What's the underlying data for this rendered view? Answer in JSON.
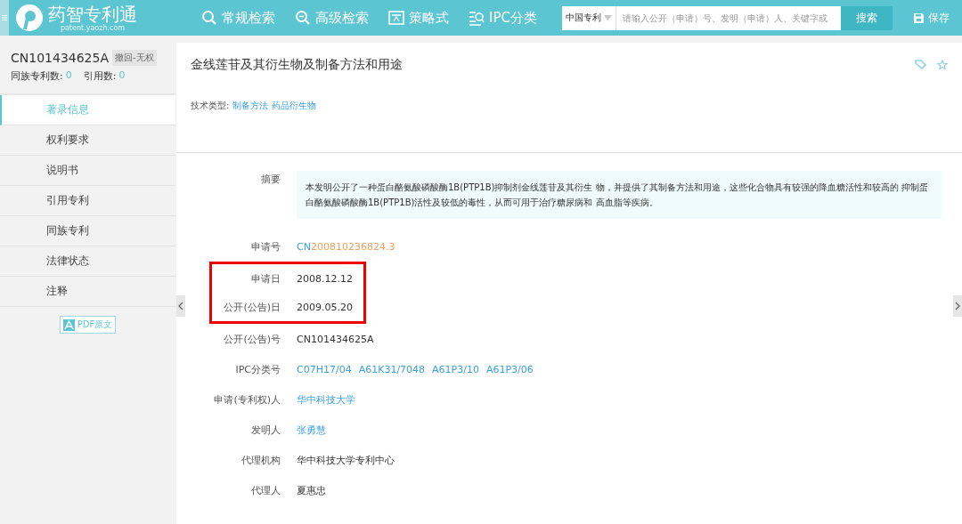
{
  "header": {
    "logo_text": "药智专利通",
    "logo_sub": "patent.yaozh.com",
    "nav": [
      {
        "label": "常规检索",
        "kind": "search"
      },
      {
        "label": "高级检索",
        "kind": "advanced"
      },
      {
        "label": "策略式",
        "kind": "strategy"
      },
      {
        "label": "IPC分类",
        "kind": "classification"
      }
    ],
    "search": {
      "scope": "中国专利",
      "placeholder": "请输入公开（申请）号、发明（申请）人、关键字或",
      "button": "搜索"
    },
    "save": "保存"
  },
  "sidebar": {
    "patent_no": "CN101434625A",
    "status": "撤回-无权",
    "family_label": "同族专利数:",
    "family_count": "0",
    "cite_label": "引用数:",
    "cite_count": "0",
    "items": [
      {
        "label": "著录信息",
        "selected": true
      },
      {
        "label": "权利要求",
        "selected": false
      },
      {
        "label": "说明书",
        "selected": false
      },
      {
        "label": "引用专利",
        "selected": false
      },
      {
        "label": "同族专利",
        "selected": false
      },
      {
        "label": "法律状态",
        "selected": false
      },
      {
        "label": "注释",
        "selected": false
      }
    ],
    "pdf": "PDF原文"
  },
  "detail": {
    "title": "金线莲苷及其衍生物及制备方法和用途",
    "tech_label": "技术类型:",
    "tech_tags": [
      "制备方法",
      "药品衍生物"
    ],
    "fields": [
      {
        "label": "摘要",
        "kind": "abstract",
        "highlighted": false,
        "value": "本发明公开了一种蛋白酪氨酸磷酸酶1B(PTP1B)抑制剂金线莲苷及其衍生 物，并提供了其制备方法和用途，这些化合物具有较强的降血糖活性和较高的 抑制蛋白酪氨酸磷酸酶1B(PTP1B)活性及较低的毒性，从而可用于治疗糖尿病和 高血脂等疾病。"
      },
      {
        "label": "申请号",
        "kind": "split",
        "highlighted": false,
        "prefix": "CN",
        "value": "200810236824.3"
      },
      {
        "label": "申请日",
        "kind": "text",
        "highlighted": true,
        "value": "2008.12.12"
      },
      {
        "label": "公开(公告)日",
        "kind": "text",
        "highlighted": true,
        "value": "2009.05.20"
      },
      {
        "label": "公开(公告)号",
        "kind": "text",
        "highlighted": false,
        "value": "CN101434625A"
      },
      {
        "label": "IPC分类号",
        "kind": "links",
        "highlighted": false,
        "values": [
          "C07H17/04",
          "A61K31/7048",
          "A61P3/10",
          "A61P3/06"
        ]
      },
      {
        "label": "申请(专利权)人",
        "kind": "links",
        "highlighted": false,
        "values": [
          "华中科技大学"
        ]
      },
      {
        "label": "发明人",
        "kind": "links",
        "highlighted": false,
        "values": [
          "张勇慧"
        ]
      },
      {
        "label": "代理机构",
        "kind": "text",
        "highlighted": false,
        "value": "华中科技大学专利中心"
      },
      {
        "label": "代理人",
        "kind": "text",
        "highlighted": false,
        "value": "夏惠忠"
      }
    ]
  }
}
